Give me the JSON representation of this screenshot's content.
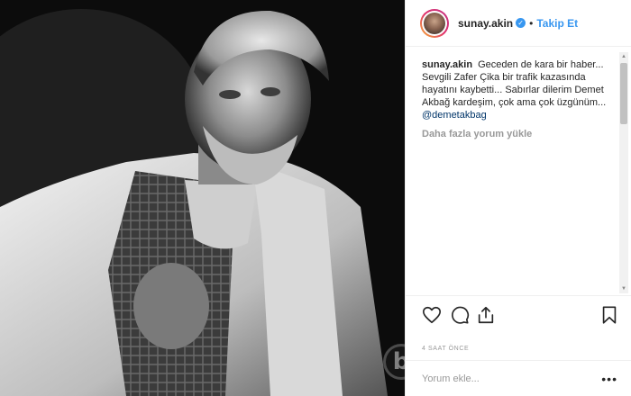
{
  "header": {
    "username": "sunay.akin",
    "verified_icon": "verified-check-icon",
    "separator": "•",
    "follow_label": "Takip Et"
  },
  "caption": {
    "username": "sunay.akin",
    "text": "Geceden de kara bir haber... Sevgili Zafer Çika bir trafik kazasında hayatını kaybetti... Sabırlar dilerim Demet Akbağ kardeşim, çok ama çok üzgünüm...",
    "mention": "@demetakbag"
  },
  "load_more_label": "Daha fazla yorum yükle",
  "actions": {
    "like_icon": "heart-icon",
    "comment_icon": "comment-icon",
    "share_icon": "share-icon",
    "save_icon": "bookmark-icon"
  },
  "timestamp": "4 SAAT ÖNCE",
  "comment_box": {
    "placeholder": "Yorum ekle...",
    "more_label": "•••"
  },
  "colors": {
    "accent": "#3897f0",
    "border": "#efefef",
    "muted": "#999999"
  }
}
